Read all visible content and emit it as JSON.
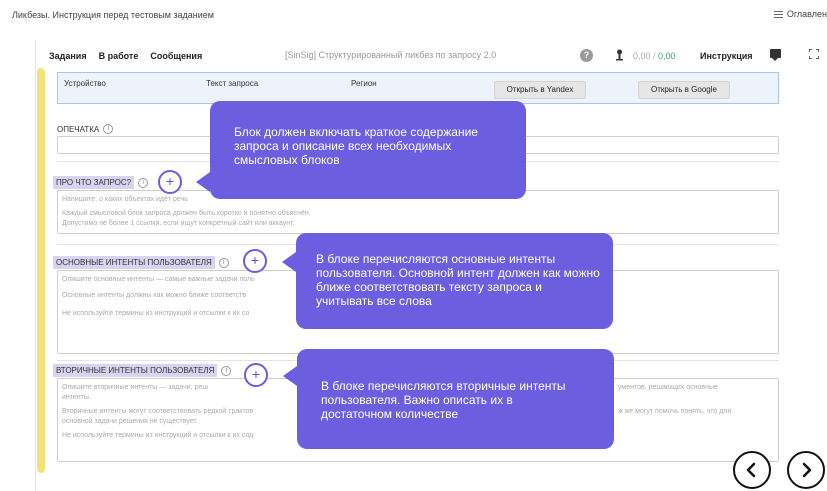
{
  "page": {
    "title": "Ликбезы. Инструкция перед тестовым заданием",
    "toc_label": "Оглавлен"
  },
  "toolbar": {
    "tabs": [
      "Задания",
      "В работе",
      "Сообщения"
    ],
    "center_title": "[SinSig] Структурированный ликбез по запросу 2.0",
    "help_icon_glyph": "?",
    "money_value": "0,00",
    "money_sep": " / ",
    "money_green": "0,00",
    "instruction_label": "Инструкция",
    "icons": [
      "help-icon",
      "money-icon",
      "chat-icon",
      "expand-icon"
    ]
  },
  "device_panel": {
    "device_label": "Устройство",
    "query_label": "Текст запроса",
    "region_label": "Регион",
    "yandex_button": "Открыть в Yandex",
    "google_button": "Открыть в Google"
  },
  "sections": {
    "typo": {
      "label": "ОПЕЧАТКА"
    },
    "about": {
      "label": "ПРО ЧТО ЗАПРОС?",
      "placeholder_1": "Напишите, о каких объектах идёт речь",
      "placeholder_2": "Каждый смысловой блок запроса должен быть коротко и понятно объяснён.",
      "placeholder_3": "Допустимо не более 1 ссылки, если ищут конкретный сайт или аккаунт."
    },
    "main_intents": {
      "label": "ОСНОВНЫЕ ИНТЕНТЫ ПОЛЬЗОВАТЕЛЯ",
      "placeholder_1": "Опишите основные интенты — самые важные задачи поль",
      "placeholder_2": "Основные интенты должны как можно ближе соответств",
      "placeholder_3": "Не используйте термины из инструкций и отсылки к их со"
    },
    "secondary_intents": {
      "label": "ВТОРИЧНЫЕ ИНТЕНТЫ ПОЛЬЗОВАТЕЛЯ",
      "placeholder_1a": "Опишите вторичные интенты — задачи, реш",
      "placeholder_1b": "ументов, решающих основные",
      "placeholder_1c": "интенты.",
      "placeholder_2a": "Вторичные интенты могут соответствовать редкой трактов",
      "placeholder_2b": "ж же могут помочь понять, что для",
      "placeholder_2c": "основной задачи решения не существует.",
      "placeholder_3": "Не используйте термины из инструкций и отсылки к их сод"
    }
  },
  "hints": {
    "hint_1": "Блок должен включать краткое содержание запроса и описание всех необходимых смысловых блоков",
    "hint_2": "В блоке перечисляются основные интенты пользователя. Основной интент должен как можно ближе соответствовать тексту запроса и учитывать все слова",
    "hint_3": "В блоке перечисляются вторичные интенты пользователя. Важно описать их в достаточном количестве",
    "plus_glyph": "+"
  },
  "navigation": {
    "icons": [
      "chevron-left-icon",
      "chevron-right-icon"
    ]
  },
  "colors": {
    "accent": "#6b5fe0",
    "tag_bg": "#d8d3f0",
    "highlight_bar": "#f3e27a",
    "panel_bg": "#edf3fb",
    "panel_border": "#a9c4e6",
    "money_green": "#3aa66a"
  }
}
